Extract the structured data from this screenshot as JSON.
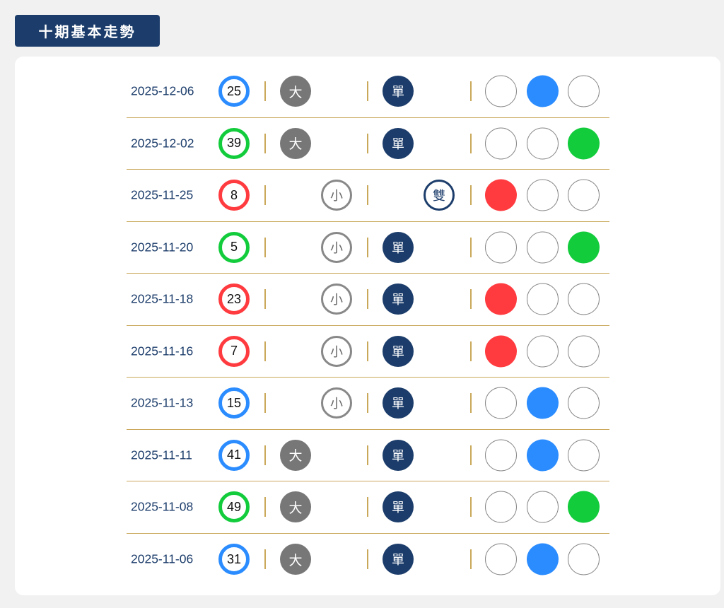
{
  "header": {
    "title": "十期基本走勢"
  },
  "colors": {
    "red": "#ff3b3f",
    "blue": "#2b8cff",
    "green": "#12cc3c",
    "navy": "#1c3d6b",
    "gold": "#c9a85a",
    "gray": "#777777"
  },
  "rows": [
    {
      "date": "2025-12-06",
      "number": "25",
      "ball_color": "blue",
      "size_label": "大",
      "size": "big",
      "parity_label": "單",
      "parity": "odd",
      "color_index": 1
    },
    {
      "date": "2025-12-02",
      "number": "39",
      "ball_color": "green",
      "size_label": "大",
      "size": "big",
      "parity_label": "單",
      "parity": "odd",
      "color_index": 2
    },
    {
      "date": "2025-11-25",
      "number": "8",
      "ball_color": "red",
      "size_label": "小",
      "size": "small",
      "parity_label": "雙",
      "parity": "even",
      "color_index": 0
    },
    {
      "date": "2025-11-20",
      "number": "5",
      "ball_color": "green",
      "size_label": "小",
      "size": "small",
      "parity_label": "單",
      "parity": "odd",
      "color_index": 2
    },
    {
      "date": "2025-11-18",
      "number": "23",
      "ball_color": "red",
      "size_label": "小",
      "size": "small",
      "parity_label": "單",
      "parity": "odd",
      "color_index": 0
    },
    {
      "date": "2025-11-16",
      "number": "7",
      "ball_color": "red",
      "size_label": "小",
      "size": "small",
      "parity_label": "單",
      "parity": "odd",
      "color_index": 0
    },
    {
      "date": "2025-11-13",
      "number": "15",
      "ball_color": "blue",
      "size_label": "小",
      "size": "small",
      "parity_label": "單",
      "parity": "odd",
      "color_index": 1
    },
    {
      "date": "2025-11-11",
      "number": "41",
      "ball_color": "blue",
      "size_label": "大",
      "size": "big",
      "parity_label": "單",
      "parity": "odd",
      "color_index": 1
    },
    {
      "date": "2025-11-08",
      "number": "49",
      "ball_color": "green",
      "size_label": "大",
      "size": "big",
      "parity_label": "單",
      "parity": "odd",
      "color_index": 2
    },
    {
      "date": "2025-11-06",
      "number": "31",
      "ball_color": "blue",
      "size_label": "大",
      "size": "big",
      "parity_label": "單",
      "parity": "odd",
      "color_index": 1
    }
  ]
}
